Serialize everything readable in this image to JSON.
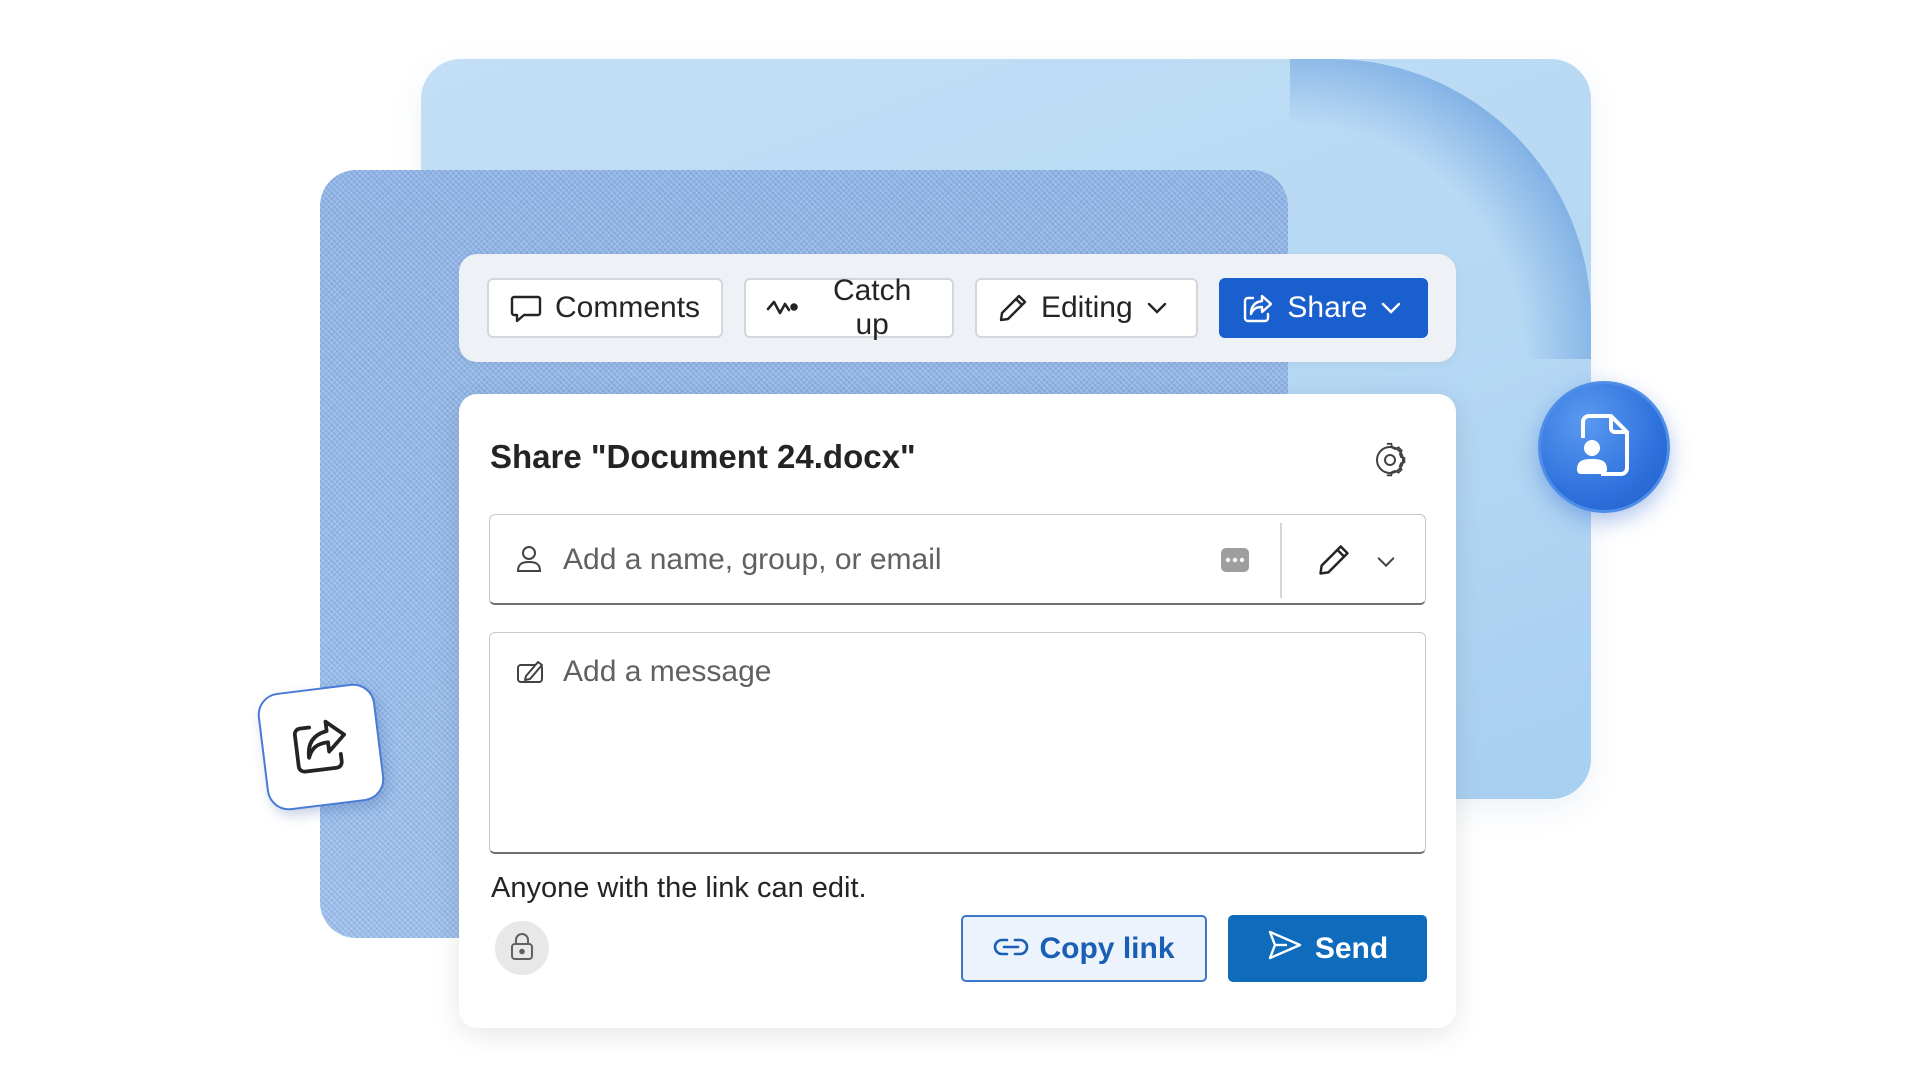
{
  "colors": {
    "accent": "#1a5fce",
    "send_button": "#0f6cbd",
    "copy_link_border": "#3b78c9",
    "background_paper": "#b6d8f3",
    "background_fabric": "#8fb6ea"
  },
  "toolbar": {
    "comments_label": "Comments",
    "comments_icon": "comment-icon",
    "catchup_label": "Catch up",
    "catchup_icon": "activity-wave-icon",
    "editing_label": "Editing",
    "editing_icon": "pencil-icon",
    "share_label": "Share",
    "share_icon": "share-arrow-icon"
  },
  "share_dialog": {
    "title": "Share \"Document 24.docx\"",
    "settings_icon": "gear-icon",
    "recipient_placeholder": "Add a name, group, or email",
    "recipient_value": "",
    "permission_icon": "pencil-icon",
    "message_placeholder": "Add a message",
    "message_value": "",
    "link_description": "Anyone with the link can edit.",
    "lock_icon": "lock-icon",
    "copy_link_label": "Copy link",
    "send_label": "Send"
  },
  "decorations": {
    "share_tile_icon": "share-arrow-icon",
    "document_person_icon": "document-person-icon"
  }
}
